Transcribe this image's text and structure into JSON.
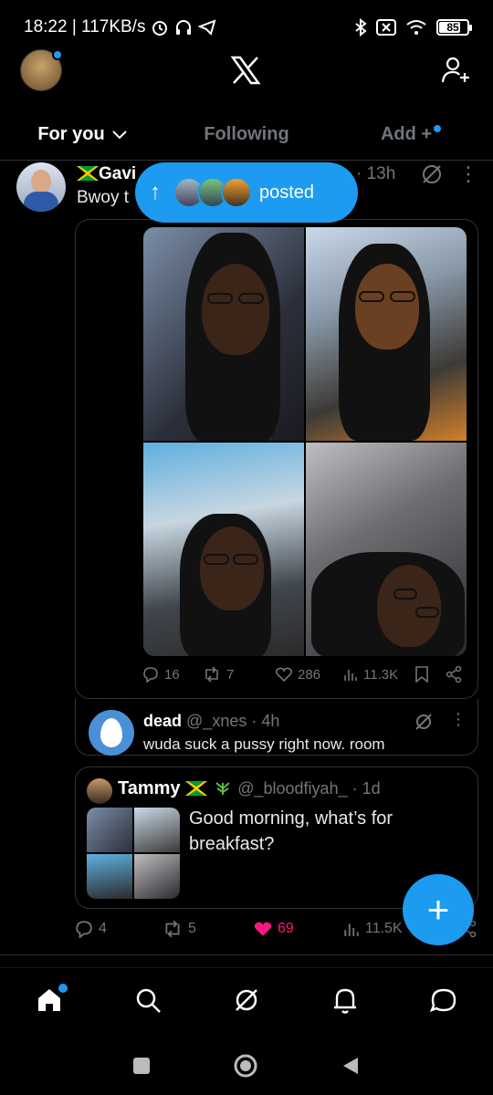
{
  "status_bar": {
    "time_speed": "18:22 | 117KB/s",
    "battery": "85"
  },
  "tabs": [
    {
      "label": "For you"
    },
    {
      "label": "Following"
    },
    {
      "label": "Add +"
    }
  ],
  "posted_pill": {
    "label": "posted"
  },
  "post": {
    "name": "Gavi",
    "text": "Bwoy t",
    "time": "· 13h",
    "actions": {
      "replies": "16",
      "reposts": "7",
      "likes": "286",
      "views": "11.3K"
    }
  },
  "reply": {
    "name": "dead",
    "handle": "@_xnes · 4h",
    "text": "wuda suck a pussy right now. room"
  },
  "quote": {
    "name": "Tammy",
    "handle": "@_bloodfiyah_ · 1d",
    "text": "Good morning, what’s for breakfast?",
    "actions": {
      "replies": "4",
      "reposts": "5",
      "likes": "69",
      "views": "11.5K"
    }
  },
  "colors": {
    "accent": "#1d9bf0",
    "like": "#f91880",
    "muted": "#71767b"
  },
  "icons": [
    "x-logo-icon",
    "add-user-icon",
    "grok-icon",
    "home-icon",
    "search-icon",
    "notification-icon",
    "messages-icon"
  ]
}
